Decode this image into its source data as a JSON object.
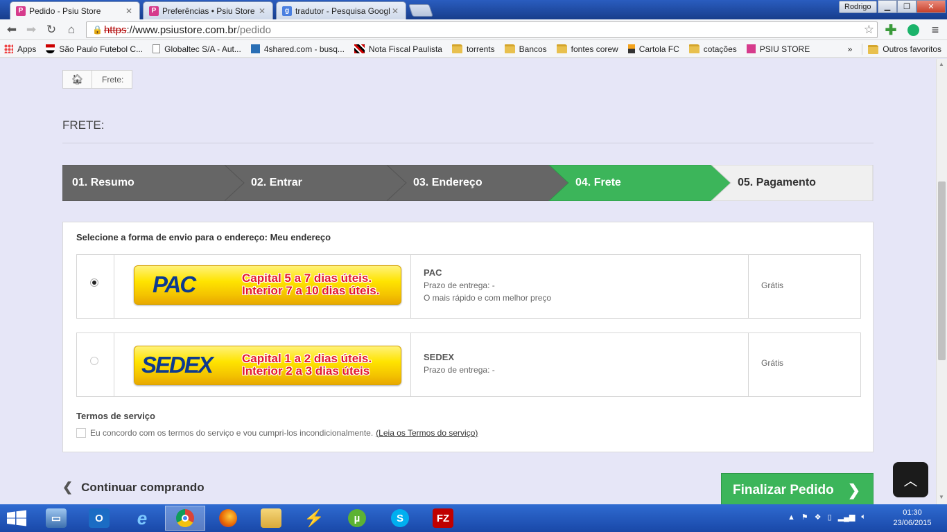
{
  "browser": {
    "tabs": [
      {
        "title": "Pedido - Psiu Store",
        "favicon": "P",
        "color": "#d63b8c"
      },
      {
        "title": "Preferências • Psiu Store",
        "favicon": "P",
        "color": "#d63b8c"
      },
      {
        "title": "tradutor - Pesquisa Googl",
        "favicon": "g",
        "color": "#4a7fe0"
      }
    ],
    "user": "Rodrigo",
    "url": {
      "scheme": "https",
      "host": "://www.psiustore.com.br",
      "path": "/pedido"
    },
    "bookmarks": [
      {
        "label": "Apps",
        "icon": "apps-icon"
      },
      {
        "label": "São Paulo Futebol C...",
        "icon": "spfc-icon"
      },
      {
        "label": "Globaltec S/A - Aut...",
        "icon": "page-icon"
      },
      {
        "label": "4shared.com - busq...",
        "icon": "4shared-icon"
      },
      {
        "label": "Nota Fiscal Paulista",
        "icon": "nfp-icon"
      },
      {
        "label": "torrents",
        "icon": "folder-icon"
      },
      {
        "label": "Bancos",
        "icon": "folder-icon"
      },
      {
        "label": "fontes corew",
        "icon": "folder-icon"
      },
      {
        "label": "Cartola FC",
        "icon": "cartola-icon"
      },
      {
        "label": "cotações",
        "icon": "folder-icon"
      },
      {
        "label": "PSIU STORE",
        "icon": "psiu-icon"
      }
    ],
    "more_bookmarks": "»",
    "other_bookmarks": "Outros favoritos"
  },
  "page": {
    "breadcrumb": {
      "current": "Frete:"
    },
    "heading": "FRETE:",
    "steps": [
      {
        "label": "01. Resumo",
        "state": "done"
      },
      {
        "label": "02. Entrar",
        "state": "done"
      },
      {
        "label": "03. Endereço",
        "state": "done"
      },
      {
        "label": "04. Frete",
        "state": "active"
      },
      {
        "label": "05. Pagamento",
        "state": "pending"
      }
    ],
    "shipping_title": "Selecione a forma de envio para o endereço: Meu endereço",
    "options": [
      {
        "selected": true,
        "banner_brand": "PAC",
        "banner_line1": "Capital 5 a 7 dias úteis.",
        "banner_line2": "Interior 7 a 10 dias úteis.",
        "name": "PAC",
        "line1": "Prazo de entrega: -",
        "line2": "O mais rápido e com melhor preço",
        "price": "Grátis"
      },
      {
        "selected": false,
        "banner_brand": "SEDEX",
        "banner_line1": "Capital 1 a 2 dias úteis.",
        "banner_line2": "Interior 2 a 3 dias úteis",
        "name": "SEDEX",
        "line1": "Prazo de entrega: -",
        "line2": "",
        "price": "Grátis"
      }
    ],
    "terms_title": "Termos de serviço",
    "terms_text": "Eu concordo com os termos do serviço e vou cumpri-los incondicionalmente.",
    "terms_link": "(Leia os Termos do serviço)",
    "continue_label": "Continuar comprando",
    "finalize_label": "Finalizar Pedido",
    "colors": {
      "step_done": "#666666",
      "step_active": "#3cb55a",
      "step_pending": "#f0f0f0",
      "finalize": "#3cb55a",
      "page_bg": "#e6e6f7"
    }
  },
  "taskbar": {
    "apps": [
      "outlook-icon",
      "internet-explorer-icon",
      "chrome-icon",
      "firefox-icon",
      "file-explorer-icon",
      "winamp-icon",
      "utorrent-icon",
      "skype-icon",
      "filezilla-icon"
    ],
    "active_app": "chrome-icon",
    "time": "01:30",
    "date": "23/06/2015"
  }
}
